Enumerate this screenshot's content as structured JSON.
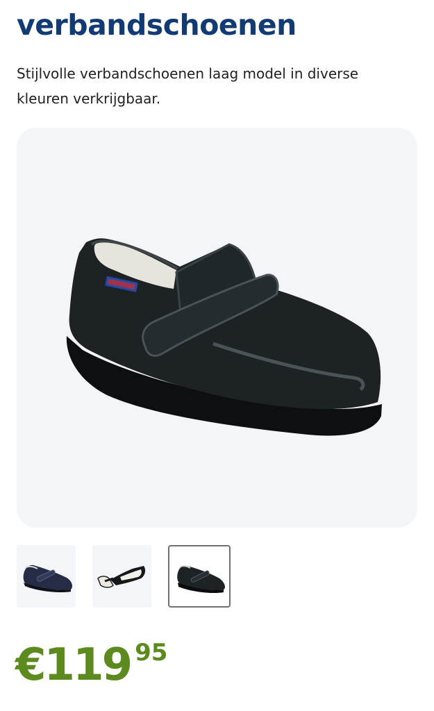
{
  "product": {
    "title": "verbandschoenen",
    "description": "Stijlvolle verbandschoenen laag model in diverse kleuren verkrijgbaar."
  },
  "gallery": {
    "main_image_icon": "shoe-black-velcro-icon",
    "thumbnails": [
      {
        "icon": "shoe-navy-velcro-icon",
        "selected": false
      },
      {
        "icon": "shoe-opened-top-view-icon",
        "selected": false
      },
      {
        "icon": "shoe-black-velcro-icon",
        "selected": true
      }
    ]
  },
  "price": {
    "currency": "€",
    "whole": "119",
    "cents": "95"
  },
  "colors": {
    "title": "#123a73",
    "price": "#5c8a1f",
    "card_background": "#f4f5f9",
    "selected_border": "#6f6f6f"
  }
}
